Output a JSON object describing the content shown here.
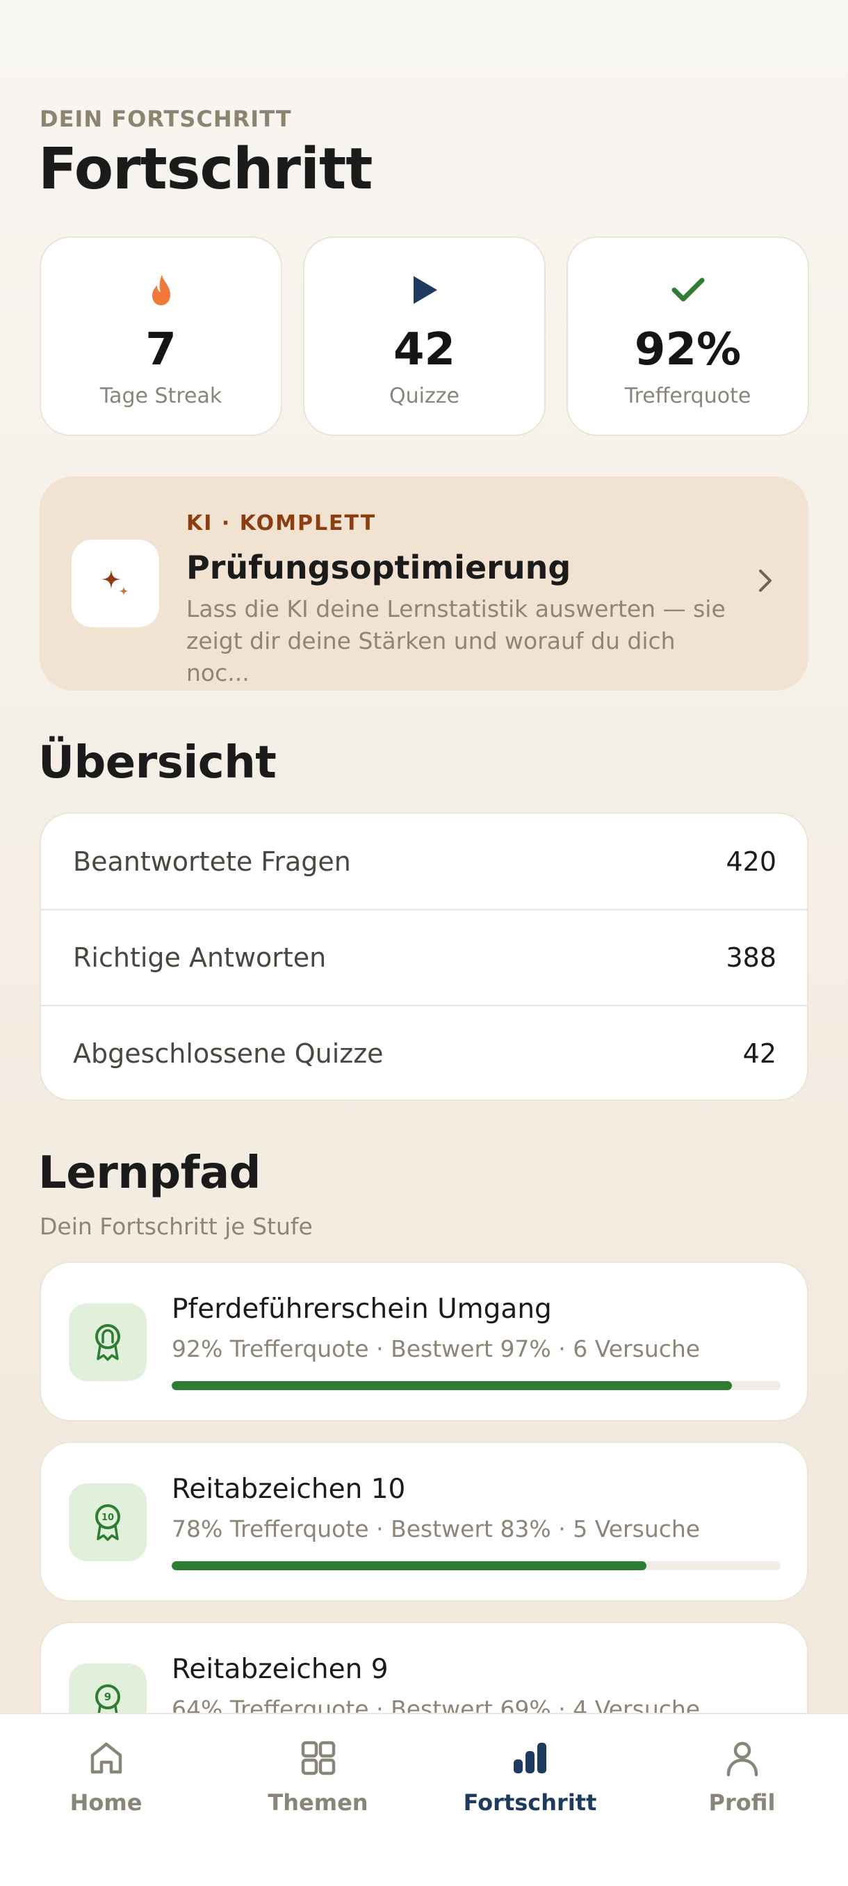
{
  "header": {
    "eyebrow": "DEIN FORTSCHRITT",
    "title": "Fortschritt"
  },
  "stats": [
    {
      "icon": "flame-icon",
      "value": "7",
      "label": "Tage Streak",
      "color": "#f07a3a"
    },
    {
      "icon": "play-icon",
      "value": "42",
      "label": "Quizze",
      "color": "#1e3a5f"
    },
    {
      "icon": "check-icon",
      "value": "92%",
      "label": "Trefferquote",
      "color": "#2e7d32"
    }
  ],
  "ki_card": {
    "eyebrow": "KI · KOMPLETT",
    "title": "Prüfungsoptimierung",
    "description": "Lass die KI deine Lernstatistik auswerten — sie zeigt dir deine Stärken und worauf du dich noc...",
    "icon": "sparkle-icon",
    "accent": "#8a3e12"
  },
  "overview": {
    "title": "Übersicht",
    "rows": [
      {
        "label": "Beantwortete Fragen",
        "value": "420"
      },
      {
        "label": "Richtige Antworten",
        "value": "388"
      },
      {
        "label": "Abgeschlossene Quizze",
        "value": "42"
      }
    ]
  },
  "lernpfad": {
    "title": "Lernpfad",
    "subtitle": "Dein Fortschritt je Stufe",
    "items": [
      {
        "title": "Pferdeführerschein Umgang",
        "meta": "92% Trefferquote · Bestwert 97% · 6 Versuche",
        "progress": 0.92,
        "badge": "horseshoe-badge-icon"
      },
      {
        "title": "Reitabzeichen 10",
        "meta": "78% Trefferquote · Bestwert 83% · 5 Versuche",
        "progress": 0.78,
        "badge_text": "10",
        "badge": "award-badge-icon"
      },
      {
        "title": "Reitabzeichen 9",
        "meta": "64% Trefferquote · Bestwert 69% · 4 Versuche",
        "progress": 0.64,
        "badge_text": "9",
        "badge": "award-badge-icon"
      }
    ]
  },
  "nav": {
    "items": [
      {
        "label": "Home",
        "icon": "home-icon"
      },
      {
        "label": "Themen",
        "icon": "grid-icon"
      },
      {
        "label": "Fortschritt",
        "icon": "bar-chart-icon",
        "active": true
      },
      {
        "label": "Profil",
        "icon": "person-icon"
      }
    ],
    "active_color": "#1e3a5f"
  }
}
